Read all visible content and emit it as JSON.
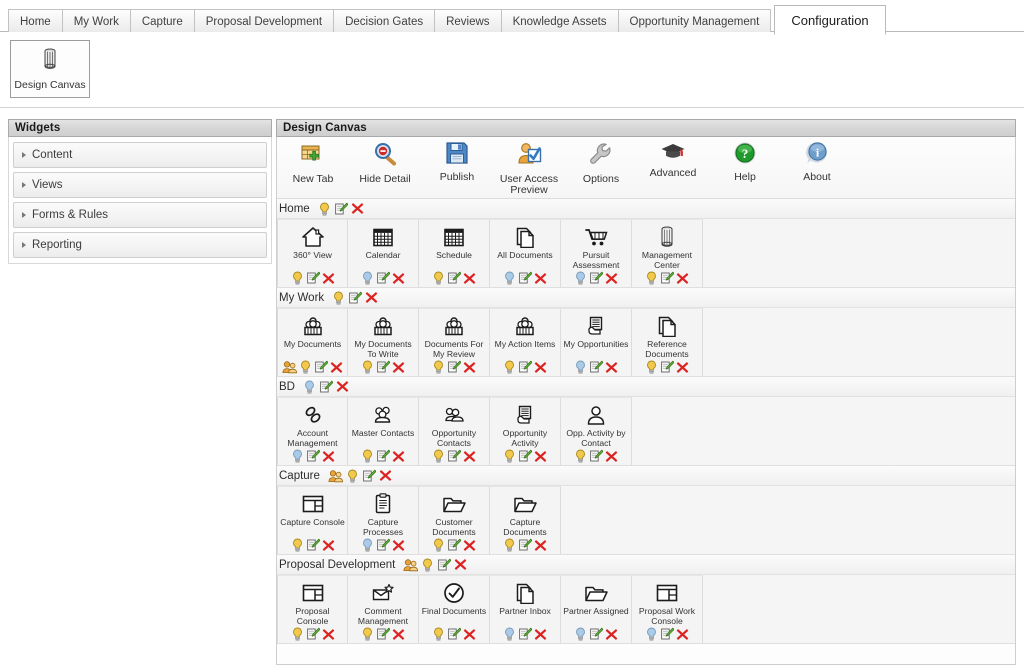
{
  "nav": {
    "tabs": [
      {
        "label": "Home",
        "active": false
      },
      {
        "label": "My Work",
        "active": false
      },
      {
        "label": "Capture",
        "active": false
      },
      {
        "label": "Proposal Development",
        "active": false
      },
      {
        "label": "Decision Gates",
        "active": false
      },
      {
        "label": "Reviews",
        "active": false
      },
      {
        "label": "Knowledge Assets",
        "active": false
      },
      {
        "label": "Opportunity Management",
        "active": false
      },
      {
        "label": "Configuration",
        "active": true
      }
    ]
  },
  "ribbon": {
    "design_canvas_button": {
      "label": "Design Canvas",
      "icon": "tower-icon"
    }
  },
  "sidebar": {
    "title": "Widgets",
    "items": [
      {
        "label": "Content"
      },
      {
        "label": "Views"
      },
      {
        "label": "Forms & Rules"
      },
      {
        "label": "Reporting"
      }
    ]
  },
  "canvas": {
    "title": "Design Canvas",
    "toolbar": [
      {
        "label": "New Tab",
        "icon": "new-tab-icon"
      },
      {
        "label": "Hide Detail",
        "icon": "magnifier-minus-icon"
      },
      {
        "label": "Publish",
        "icon": "floppy-disk-icon"
      },
      {
        "label": "User Access Preview",
        "icon": "user-check-icon"
      },
      {
        "label": "Options",
        "icon": "wrench-icon"
      },
      {
        "label": "Advanced",
        "icon": "graduation-cap-icon"
      },
      {
        "label": "Help",
        "icon": "help-circle-icon"
      },
      {
        "label": "About",
        "icon": "info-balloon-icon"
      }
    ],
    "groups": [
      {
        "name": "Home",
        "actions": [
          "bulb-yellow",
          "edit",
          "delete"
        ],
        "widgets": [
          {
            "name": "360° View",
            "icon": "house-icon",
            "actions": [
              "bulb-yellow",
              "edit",
              "delete"
            ]
          },
          {
            "name": "Calendar",
            "icon": "calendar-icon",
            "actions": [
              "bulb-blue",
              "edit",
              "delete"
            ]
          },
          {
            "name": "Schedule",
            "icon": "calendar-icon",
            "actions": [
              "bulb-yellow",
              "edit",
              "delete"
            ]
          },
          {
            "name": "All Documents",
            "icon": "documents-icon",
            "actions": [
              "bulb-blue",
              "edit",
              "delete"
            ]
          },
          {
            "name": "Pursuit Assessment",
            "icon": "cart-icon",
            "actions": [
              "bulb-blue",
              "edit",
              "delete"
            ]
          },
          {
            "name": "Management Center",
            "icon": "tower-icon",
            "actions": [
              "bulb-yellow",
              "edit",
              "delete"
            ]
          }
        ]
      },
      {
        "name": "My Work",
        "actions": [
          "bulb-yellow",
          "edit",
          "delete"
        ],
        "widgets": [
          {
            "name": "My Documents",
            "icon": "briefcase-people-icon",
            "actions": [
              "people-orange",
              "bulb-yellow",
              "edit",
              "delete"
            ]
          },
          {
            "name": "My Documents To Write",
            "icon": "briefcase-people-icon",
            "actions": [
              "bulb-yellow",
              "edit",
              "delete"
            ]
          },
          {
            "name": "Documents For My Review",
            "icon": "briefcase-people-icon",
            "actions": [
              "bulb-yellow",
              "edit",
              "delete"
            ]
          },
          {
            "name": "My Action Items",
            "icon": "briefcase-people-icon",
            "actions": [
              "bulb-yellow",
              "edit",
              "delete"
            ]
          },
          {
            "name": "My Opportunities",
            "icon": "contract-hand-icon",
            "actions": [
              "bulb-blue",
              "edit",
              "delete"
            ]
          },
          {
            "name": "Reference Documents",
            "icon": "documents-icon",
            "actions": [
              "bulb-yellow",
              "edit",
              "delete"
            ]
          }
        ]
      },
      {
        "name": "BD",
        "actions": [
          "bulb-blue",
          "edit",
          "delete"
        ],
        "widgets": [
          {
            "name": "Account Management",
            "icon": "link-chain-icon",
            "actions": [
              "bulb-blue",
              "edit",
              "delete"
            ]
          },
          {
            "name": "Master Contacts",
            "icon": "people-group-icon",
            "actions": [
              "bulb-yellow",
              "edit",
              "delete"
            ]
          },
          {
            "name": "Opportunity Contacts",
            "icon": "people-pair-icon",
            "actions": [
              "bulb-yellow",
              "edit",
              "delete"
            ]
          },
          {
            "name": "Opportunity Activity",
            "icon": "contract-hand-icon",
            "actions": [
              "bulb-yellow",
              "edit",
              "delete"
            ]
          },
          {
            "name": "Opp. Activity by Contact",
            "icon": "person-icon",
            "actions": [
              "bulb-yellow",
              "edit",
              "delete"
            ]
          }
        ]
      },
      {
        "name": "Capture",
        "actions": [
          "people-orange",
          "bulb-yellow",
          "edit",
          "delete"
        ],
        "widgets": [
          {
            "name": "Capture Console",
            "icon": "console-layout-icon",
            "actions": [
              "bulb-yellow",
              "edit",
              "delete"
            ]
          },
          {
            "name": "Capture Processes",
            "icon": "clipboard-icon",
            "actions": [
              "bulb-blue",
              "edit",
              "delete"
            ]
          },
          {
            "name": "Customer Documents",
            "icon": "folder-open-icon",
            "actions": [
              "bulb-yellow",
              "edit",
              "delete"
            ]
          },
          {
            "name": "Capture Documents",
            "icon": "folder-open-icon",
            "actions": [
              "bulb-yellow",
              "edit",
              "delete"
            ]
          }
        ]
      },
      {
        "name": "Proposal Development",
        "actions": [
          "people-orange",
          "bulb-yellow",
          "edit",
          "delete"
        ],
        "widgets": [
          {
            "name": "Proposal Console",
            "icon": "console-layout-icon",
            "actions": [
              "bulb-yellow",
              "edit",
              "delete"
            ]
          },
          {
            "name": "Comment Management",
            "icon": "envelope-star-icon",
            "actions": [
              "bulb-yellow",
              "edit",
              "delete"
            ]
          },
          {
            "name": "Final Documents",
            "icon": "check-circle-icon",
            "actions": [
              "bulb-yellow",
              "edit",
              "delete"
            ]
          },
          {
            "name": "Partner Inbox",
            "icon": "documents-icon",
            "actions": [
              "bulb-blue",
              "edit",
              "delete"
            ]
          },
          {
            "name": "Partner Assigned",
            "icon": "folder-open-icon",
            "actions": [
              "bulb-blue",
              "edit",
              "delete"
            ]
          },
          {
            "name": "Proposal Work Console",
            "icon": "console-layout-icon",
            "actions": [
              "bulb-blue",
              "edit",
              "delete"
            ]
          }
        ]
      }
    ]
  },
  "colors": {
    "bulb_yellow": "#f2c94c",
    "bulb_blue": "#aacbe8",
    "delete_red": "#dd2222",
    "edit_green": "#5ea63a",
    "people_orange": "#e8a33d",
    "panel_border": "#a9a9a9"
  }
}
